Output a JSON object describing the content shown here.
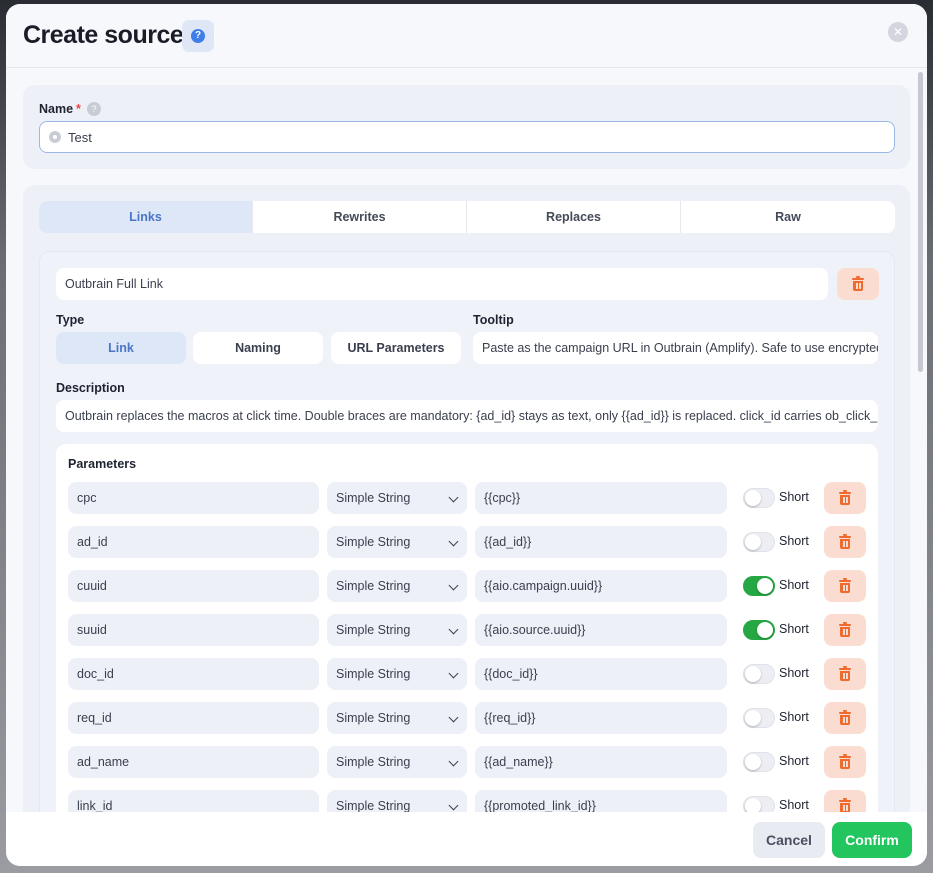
{
  "header": {
    "title": "Create source",
    "help_icon": "question-icon",
    "close_icon": "close-icon"
  },
  "name_section": {
    "label": "Name",
    "required_mark": "*",
    "value": "Test"
  },
  "tabs": [
    {
      "label": "Links",
      "active": true
    },
    {
      "label": "Rewrites",
      "active": false
    },
    {
      "label": "Replaces",
      "active": false
    },
    {
      "label": "Raw",
      "active": false
    }
  ],
  "link": {
    "name": "Outbrain Full Link",
    "type_label": "Type",
    "type_options": [
      {
        "label": "Link",
        "active": true
      },
      {
        "label": "Naming",
        "active": false
      },
      {
        "label": "URL Parameters",
        "active": false
      }
    ],
    "tooltip_label": "Tooltip",
    "tooltip_value": "Paste as the campaign URL in Outbrain (Amplify). Safe to use encrypted",
    "description_label": "Description",
    "description_value": "Outbrain replaces the macros at click time. Double braces are mandatory: {ad_id} stays as text, only {{ad_id}} is replaced. click_id carries ob_click_id",
    "parameters_label": "Parameters",
    "short_label": "Short",
    "parameters": [
      {
        "name": "cpc",
        "type": "Simple String",
        "value": "{{cpc}}",
        "short": false
      },
      {
        "name": "ad_id",
        "type": "Simple String",
        "value": "{{ad_id}}",
        "short": false
      },
      {
        "name": "cuuid",
        "type": "Simple String",
        "value": "{{aio.campaign.uuid}}",
        "short": true
      },
      {
        "name": "suuid",
        "type": "Simple String",
        "value": "{{aio.source.uuid}}",
        "short": true
      },
      {
        "name": "doc_id",
        "type": "Simple String",
        "value": "{{doc_id}}",
        "short": false
      },
      {
        "name": "req_id",
        "type": "Simple String",
        "value": "{{req_id}}",
        "short": false
      },
      {
        "name": "ad_name",
        "type": "Simple String",
        "value": "{{ad_name}}",
        "short": false
      },
      {
        "name": "link_id",
        "type": "Simple String",
        "value": "{{promoted_link_id}}",
        "short": false
      }
    ]
  },
  "footer": {
    "cancel_label": "Cancel",
    "confirm_label": "Confirm"
  },
  "colors": {
    "accent": "#4a76c4",
    "confirm": "#22c55e",
    "danger": "#ee6a2f",
    "toggle_on": "#25a843"
  }
}
